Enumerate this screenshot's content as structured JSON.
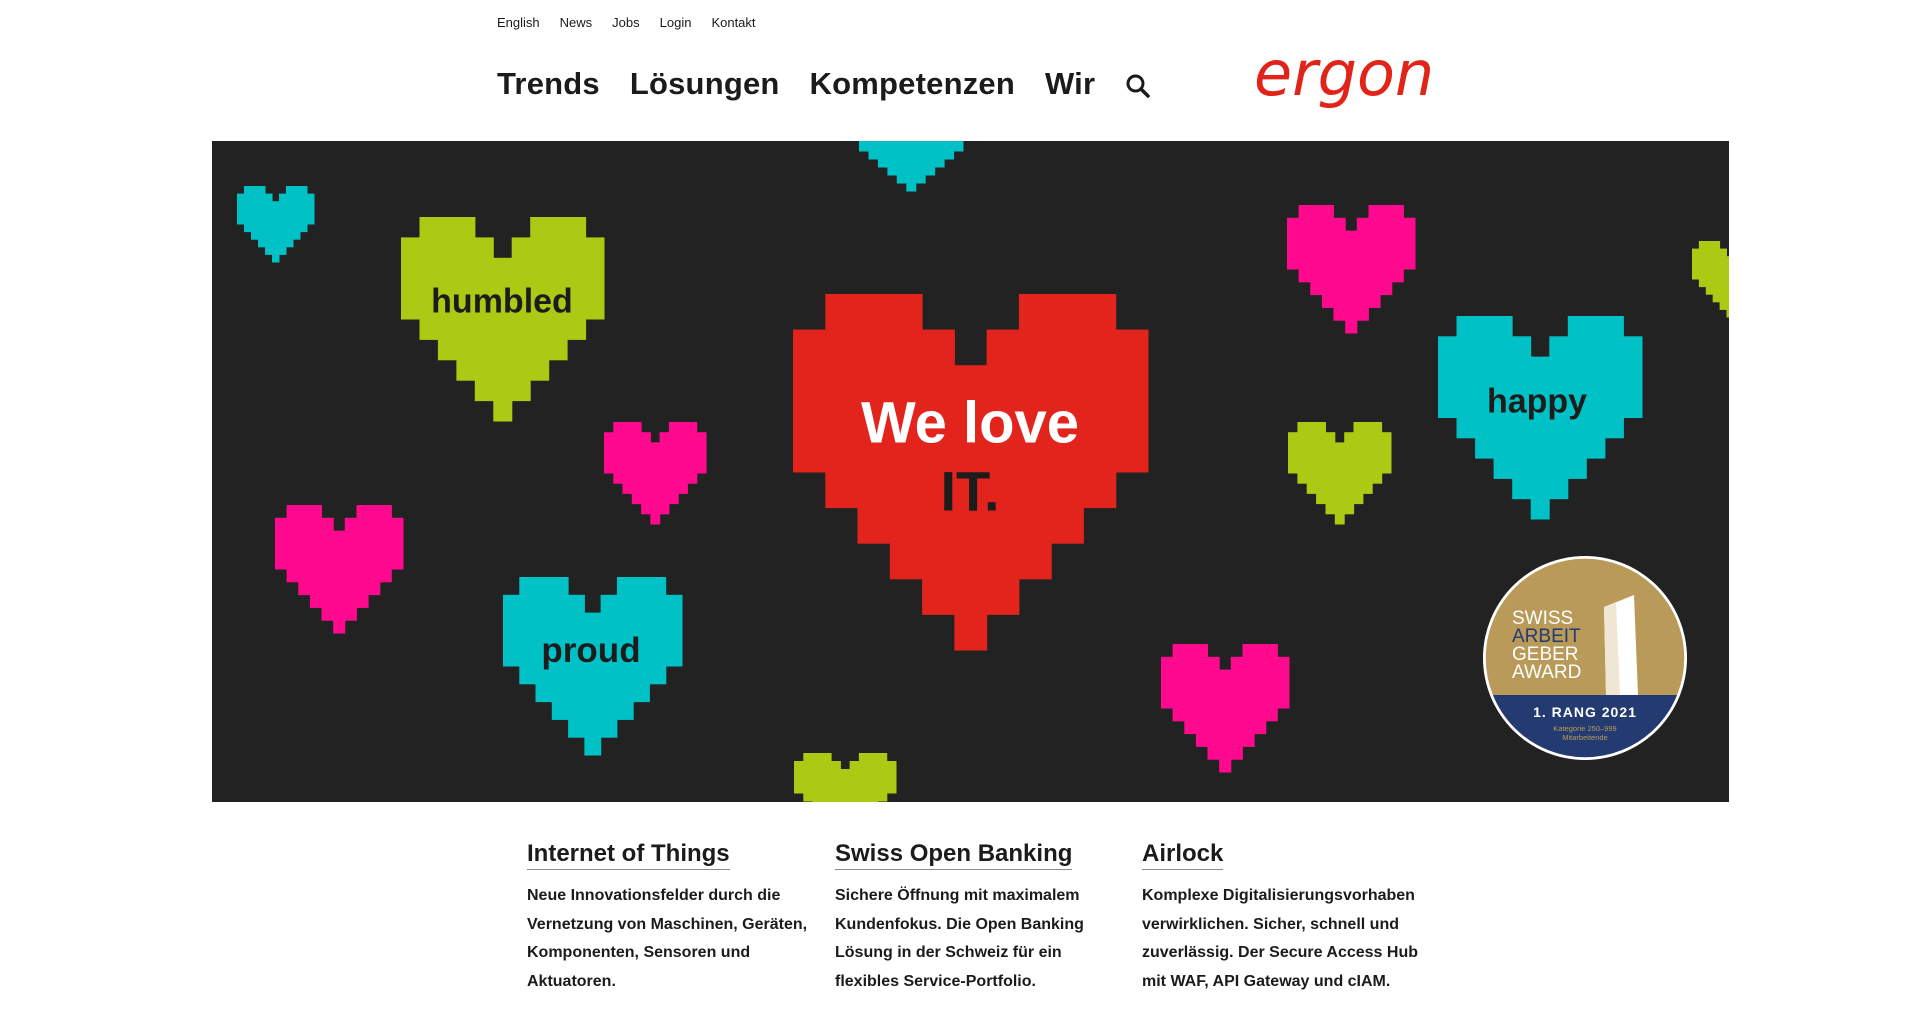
{
  "top_nav": {
    "items": [
      {
        "label": "English"
      },
      {
        "label": "News"
      },
      {
        "label": "Jobs"
      },
      {
        "label": "Login"
      },
      {
        "label": "Kontakt"
      }
    ]
  },
  "main_nav": {
    "items": [
      {
        "label": "Trends"
      },
      {
        "label": "Lösungen"
      },
      {
        "label": "Kompetenzen"
      },
      {
        "label": "Wir"
      }
    ],
    "search_icon": "search-icon"
  },
  "logo": {
    "text": "ergon",
    "color": "#e2231a"
  },
  "hero": {
    "background": "#222222",
    "heart_labels": {
      "humbled": "humbled",
      "proud": "proud",
      "happy": "happy"
    },
    "center_line1": "We love",
    "center_line2": "IT.",
    "colors": {
      "red": "#e3241d",
      "lime": "#acca14",
      "cyan": "#00c2c6",
      "pink": "#ff0a8e"
    }
  },
  "award": {
    "line1": "SWISS",
    "line2": "ARBEIT",
    "line3": "GEBER",
    "line4": "AWARD",
    "rank": "1. RANG 2021",
    "category_line1": "Kategorie 250–999",
    "category_line2": "Mitarbeitende",
    "colors": {
      "gold": "#b99a59",
      "navy": "#243b72"
    }
  },
  "cards": [
    {
      "title": "Internet of Things",
      "text": "Neue Innovationsfelder durch die Vernetzung von Maschinen, Geräten, Komponenten, Sensoren und Aktuatoren."
    },
    {
      "title": "Swiss Open Banking",
      "text": "Sichere Öffnung mit maximalem Kundenfokus. Die Open Banking Lösung in der Schweiz für ein flexibles Service-Portfolio."
    },
    {
      "title": "Airlock",
      "text": "Komplexe Digitalisierungsvorhaben verwirklichen. Sicher, schnell und zuverlässig. Der Secure Access Hub mit WAF, API Gateway und cIAM."
    }
  ]
}
